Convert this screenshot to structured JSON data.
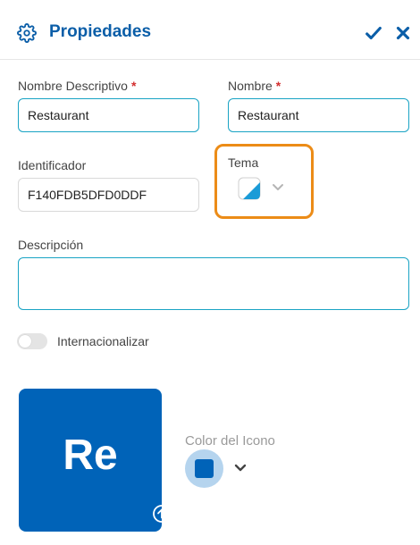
{
  "header": {
    "title": "Propiedades",
    "accent_color": "#0b5ea8",
    "icons": {
      "settings": "gear-icon",
      "confirm": "check-icon",
      "close": "close-icon"
    }
  },
  "form": {
    "descriptive_name": {
      "label": "Nombre Descriptivo",
      "required_mark": "*",
      "value": "Restaurant"
    },
    "name": {
      "label": "Nombre",
      "required_mark": "*",
      "value": "Restaurant"
    },
    "identifier": {
      "label": "Identificador",
      "value": "F140FDB5DFD0DDF"
    },
    "theme": {
      "label": "Tema",
      "highlight_color": "#ec8c17"
    },
    "description": {
      "label": "Descripción",
      "value": ""
    },
    "internationalize": {
      "label": "Internacionalizar",
      "enabled": false
    }
  },
  "icon_card": {
    "initials": "Re",
    "background_color": "#0063b8"
  },
  "icon_color": {
    "label": "Color del Icono",
    "selected_color": "#0063b8"
  }
}
